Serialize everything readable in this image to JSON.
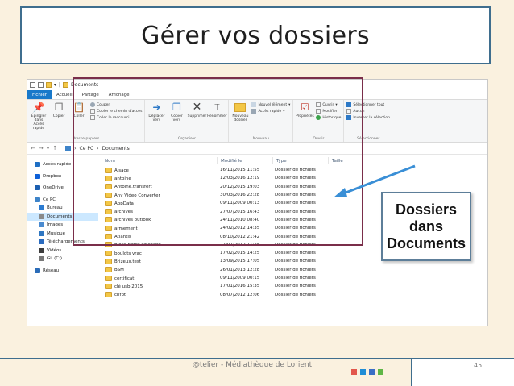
{
  "slide": {
    "title": "Gérer vos dossiers",
    "footer": "@telier - Médiathèque de Lorient",
    "page_number": "45",
    "callout": "Dossiers dans Documents",
    "square_colors": [
      "#e2574c",
      "#1f8dd6",
      "#3a6ec5",
      "#5fb646"
    ]
  },
  "explorer": {
    "window_title": "Documents",
    "tabs": [
      "Fichier",
      "Accueil",
      "Partage",
      "Affichage"
    ],
    "groups": {
      "clipboard": {
        "label": "Presse-papiers",
        "pin": "Épingler dans Accès rapide",
        "copy": "Copier",
        "paste": "Coller",
        "cut": "Couper",
        "copy_path": "Copier le chemin d'accès",
        "paste_shortcut": "Coller le raccourci"
      },
      "organize": {
        "label": "Organiser",
        "move": "Déplacer vers",
        "copy_to": "Copier vers",
        "delete": "Supprimer",
        "rename": "Renommer"
      },
      "new": {
        "label": "Nouveau",
        "new_folder": "Nouveau dossier",
        "new_item": "Nouvel élément",
        "easy_access": "Accès rapide"
      },
      "open": {
        "label": "Ouvrir",
        "properties": "Propriétés",
        "open": "Ouvrir",
        "edit": "Modifier",
        "history": "Historique"
      },
      "select": {
        "label": "Sélectionner",
        "select_all": "Sélectionner tout",
        "select_none": "Aucun",
        "invert": "Inverser la sélection"
      }
    },
    "address": {
      "pc": "Ce PC",
      "folder": "Documents"
    },
    "nav": [
      {
        "label": "Accès rapide",
        "color": "#1f6fc4",
        "sub": false,
        "selected": false,
        "gap": false
      },
      {
        "label": "Dropbox",
        "color": "#0f61d8",
        "sub": false,
        "selected": false,
        "gap": true
      },
      {
        "label": "OneDrive",
        "color": "#1c5fb0",
        "sub": false,
        "selected": false,
        "gap": true
      },
      {
        "label": "Ce PC",
        "color": "#3e84c9",
        "sub": false,
        "selected": false,
        "gap": true
      },
      {
        "label": "Bureau",
        "color": "#2b7bd1",
        "sub": true,
        "selected": false,
        "gap": false
      },
      {
        "label": "Documents",
        "color": "#8a8a8a",
        "sub": true,
        "selected": true,
        "gap": false
      },
      {
        "label": "Images",
        "color": "#4a8bd0",
        "sub": true,
        "selected": false,
        "gap": false
      },
      {
        "label": "Musique",
        "color": "#2f77c2",
        "sub": true,
        "selected": false,
        "gap": false
      },
      {
        "label": "Téléchargements",
        "color": "#2a6bbf",
        "sub": true,
        "selected": false,
        "gap": false
      },
      {
        "label": "Vidéos",
        "color": "#3c3c3c",
        "sub": true,
        "selected": false,
        "gap": false
      },
      {
        "label": "Gil (C:)",
        "color": "#777777",
        "sub": true,
        "selected": false,
        "gap": false
      },
      {
        "label": "Réseau",
        "color": "#2b6cb8",
        "sub": false,
        "selected": false,
        "gap": true
      }
    ],
    "columns": [
      "Nom",
      "Modifié le",
      "Type",
      "Taille"
    ],
    "files": [
      {
        "name": "Alsace",
        "modified": "16/11/2015 11:55",
        "type": "Dossier de fichiers"
      },
      {
        "name": "antoine",
        "modified": "12/03/2016 12:19",
        "type": "Dossier de fichiers"
      },
      {
        "name": "Antoine.transfert",
        "modified": "20/12/2015 19:03",
        "type": "Dossier de fichiers"
      },
      {
        "name": "Any Video Converter",
        "modified": "30/03/2016 22:28",
        "type": "Dossier de fichiers"
      },
      {
        "name": "AppData",
        "modified": "09/11/2009 00:13",
        "type": "Dossier de fichiers"
      },
      {
        "name": "archives",
        "modified": "27/07/2015 16:43",
        "type": "Dossier de fichiers"
      },
      {
        "name": "archives outlook",
        "modified": "24/11/2010 08:40",
        "type": "Dossier de fichiers"
      },
      {
        "name": "armement",
        "modified": "24/02/2012 14:35",
        "type": "Dossier de fichiers"
      },
      {
        "name": "Atlantis",
        "modified": "08/10/2012 21:42",
        "type": "Dossier de fichiers"
      },
      {
        "name": "Blocs-notes OneNote",
        "modified": "27/07/2012 11:28",
        "type": "Dossier de fichiers"
      },
      {
        "name": "boulots vrac",
        "modified": "17/02/2015 14:25",
        "type": "Dossier de fichiers"
      },
      {
        "name": "Brizeux.test",
        "modified": "13/09/2015 17:05",
        "type": "Dossier de fichiers"
      },
      {
        "name": "BSM",
        "modified": "26/01/2013 12:28",
        "type": "Dossier de fichiers"
      },
      {
        "name": "certificat",
        "modified": "09/11/2009 00:15",
        "type": "Dossier de fichiers"
      },
      {
        "name": "clé usb 2015",
        "modified": "17/01/2016 15:35",
        "type": "Dossier de fichiers"
      },
      {
        "name": "cnfpt",
        "modified": "08/07/2012 12:06",
        "type": "Dossier de fichiers"
      }
    ]
  }
}
